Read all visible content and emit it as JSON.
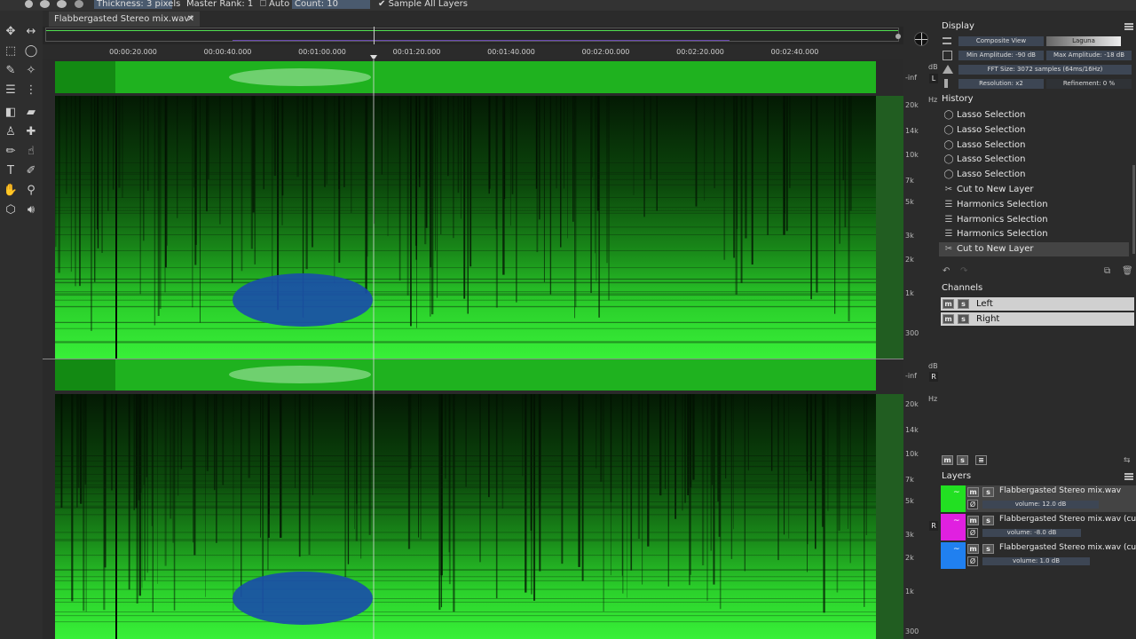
{
  "topbar": {
    "thickness": "Thickness: 3 pixels",
    "master_rank": "Master Rank: 1",
    "auto": "Auto",
    "count": "Count: 10",
    "sample_all_layers": "Sample All Layers",
    "check": "✔"
  },
  "file_tab": {
    "name": "Flabbergasted Stereo mix.wav*",
    "close": "✕"
  },
  "ruler": {
    "ticks": [
      "00:00:20.000",
      "00:00:40.000",
      "00:01:00.000",
      "00:01:20.000",
      "00:01:40.000",
      "00:02:00.000",
      "00:02:20.000",
      "00:02:40.000"
    ]
  },
  "scale": {
    "db": "dB",
    "inf": "-inf",
    "hz": "Hz",
    "left_label": "L",
    "right_label": "R",
    "freq_labels": [
      "20k",
      "14k",
      "10k",
      "7k",
      "5k",
      "3k",
      "2k",
      "1k",
      "300"
    ]
  },
  "display": {
    "title": "Display",
    "composite_view": "Composite View",
    "colormap": "Laguna",
    "min_amplitude": "Min Amplitude: -90 dB",
    "max_amplitude": "Max Amplitude: -18 dB",
    "fft_size": "FFT Size: 3072 samples (64ms/16Hz)",
    "resolution": "Resolution: x2",
    "refinement": "Refinement: 0 %"
  },
  "history": {
    "title": "History",
    "items": [
      {
        "label": "Lasso Selection",
        "icon": "lasso-icon"
      },
      {
        "label": "Lasso Selection",
        "icon": "lasso-icon"
      },
      {
        "label": "Lasso Selection",
        "icon": "lasso-icon"
      },
      {
        "label": "Lasso Selection",
        "icon": "lasso-icon"
      },
      {
        "label": "Lasso Selection",
        "icon": "lasso-icon"
      },
      {
        "label": "Cut to New Layer",
        "icon": "scissors-icon"
      },
      {
        "label": "Harmonics Selection",
        "icon": "harmonics-icon"
      },
      {
        "label": "Harmonics Selection",
        "icon": "harmonics-icon"
      },
      {
        "label": "Harmonics Selection",
        "icon": "harmonics-icon"
      },
      {
        "label": "Cut to New Layer",
        "icon": "scissors-icon",
        "selected": true
      }
    ]
  },
  "channels": {
    "title": "Channels",
    "items": [
      {
        "label": "Left"
      },
      {
        "label": "Right"
      }
    ],
    "m": "m",
    "s": "s"
  },
  "layers": {
    "title": "Layers",
    "items": [
      {
        "name": "Flabbergasted Stereo mix.wav",
        "volume": "volume: 12.0 dB",
        "color": "#22e022",
        "volume_level": 0.77
      },
      {
        "name": "Flabbergasted Stereo mix.wav (cut)",
        "volume": "volume: -8.0 dB",
        "color": "#e020e0",
        "volume_level": 0.65
      },
      {
        "name": "Flabbergasted Stereo mix.wav (cut)",
        "volume": "volume: 1.0 dB",
        "color": "#2080f0",
        "volume_level": 0.71
      }
    ]
  }
}
